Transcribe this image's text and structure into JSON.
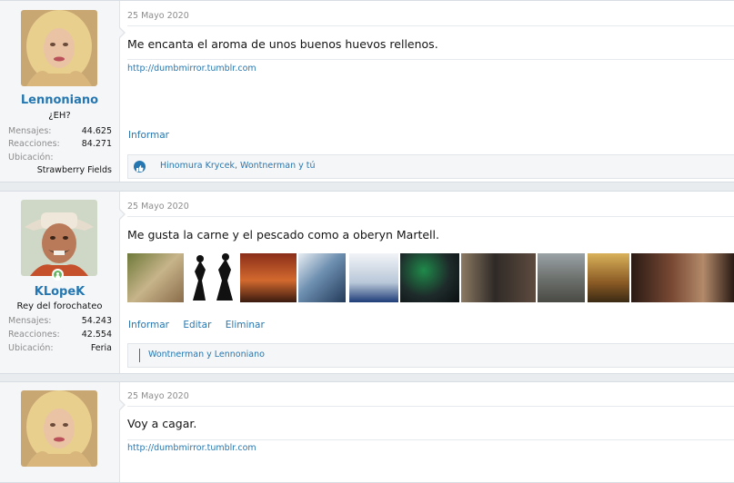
{
  "posts": [
    {
      "user": {
        "name": "Lennoniano",
        "title": "¿EH?",
        "avatar": "blonde-woman-avatar"
      },
      "stats": [
        {
          "label": "Mensajes:",
          "value": "44.625"
        },
        {
          "label": "Reacciones:",
          "value": "84.271"
        },
        {
          "label": "Ubicación:",
          "value": ""
        }
      ],
      "location_value": "Strawberry Fields",
      "date": "25 Mayo 2020",
      "message": "Me encanta el aroma de unos buenos huevos rellenos.",
      "signature": "http://dumbmirror.tumblr.com",
      "actions": [
        "Informar"
      ],
      "reactions": "Hinomura Krycek, Wontnerman y tú"
    },
    {
      "user": {
        "name": "KLopeK",
        "title": "Rey del forochateo",
        "avatar": "cowboy-man-avatar"
      },
      "stats": [
        {
          "label": "Mensajes:",
          "value": "54.243"
        },
        {
          "label": "Reacciones:",
          "value": "42.554"
        },
        {
          "label": "Ubicación:",
          "value": "Feria"
        }
      ],
      "date": "25 Mayo 2020",
      "message": "Me gusta la carne y el pescado como a oberyn Martell.",
      "actions": [
        "Informar",
        "Editar",
        "Eliminar"
      ],
      "reactions": "Wontnerman y Lennoniano"
    },
    {
      "user": {
        "name": "",
        "title": "",
        "avatar": "blonde-woman-avatar"
      },
      "date": "25 Mayo 2020",
      "message": "Voy a cagar.",
      "signature": "http://dumbmirror.tumblr.com"
    }
  ],
  "colors": {
    "link": "#2577b1",
    "muted": "#8c8c8c",
    "online": "#63b65f"
  }
}
